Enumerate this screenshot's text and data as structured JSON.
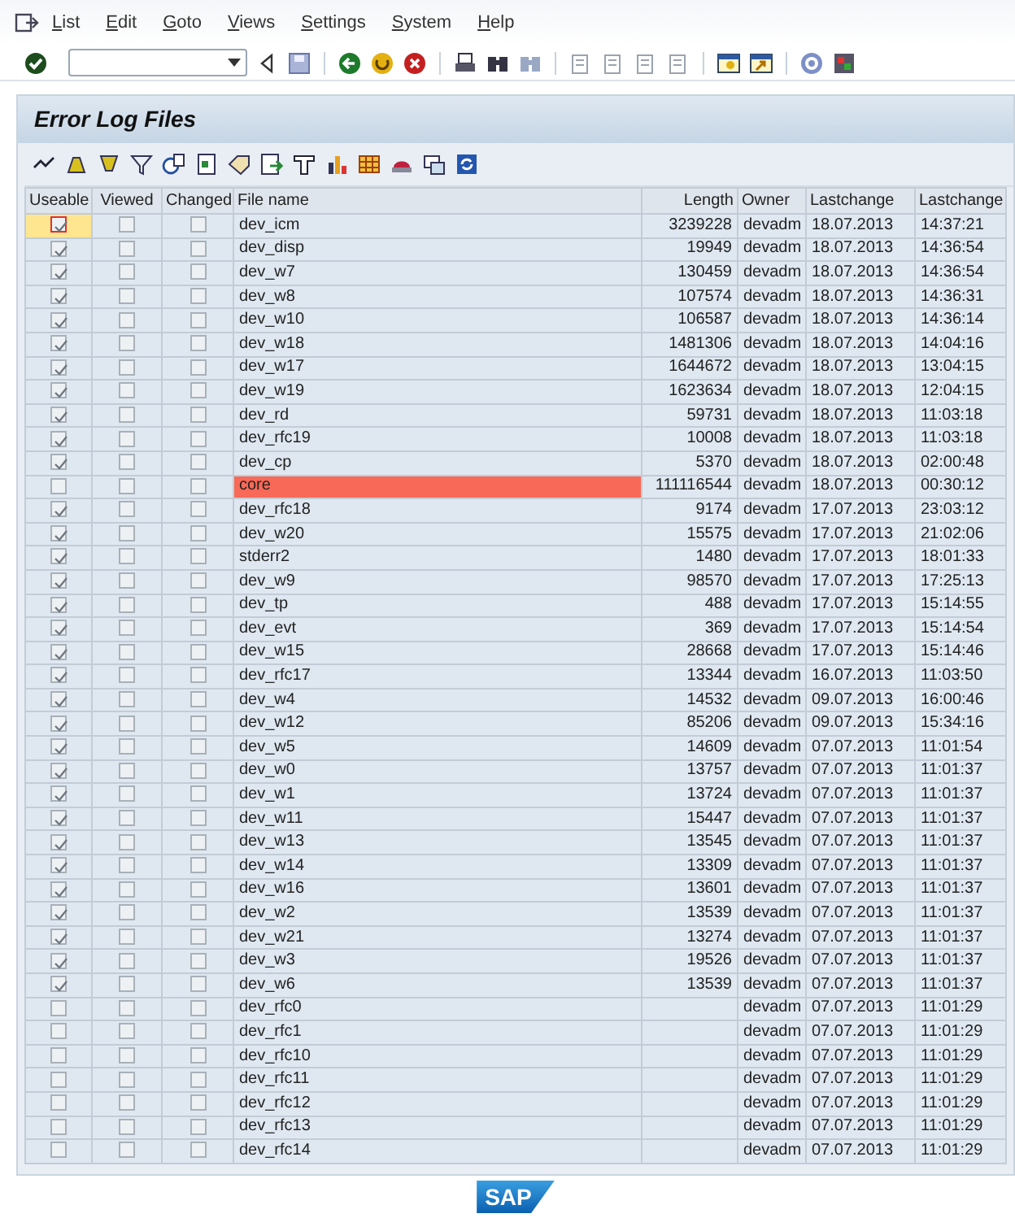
{
  "menu": [
    {
      "label": "List"
    },
    {
      "label": "Edit"
    },
    {
      "label": "Goto"
    },
    {
      "label": "Views"
    },
    {
      "label": "Settings"
    },
    {
      "label": "System"
    },
    {
      "label": "Help"
    }
  ],
  "title": "Error Log Files",
  "table": {
    "columns": [
      "Useable",
      "Viewed",
      "Changed",
      "File name",
      "Length",
      "Owner",
      "Lastchange",
      "Lastchange"
    ],
    "rows": [
      {
        "useable": true,
        "viewed": false,
        "changed": false,
        "file_name": "dev_icm",
        "length": "3239228",
        "owner": "devadm",
        "date": "18.07.2013",
        "time": "14:37:21",
        "error": false,
        "focused": true
      },
      {
        "useable": true,
        "viewed": false,
        "changed": false,
        "file_name": "dev_disp",
        "length": "19949",
        "owner": "devadm",
        "date": "18.07.2013",
        "time": "14:36:54",
        "error": false,
        "focused": false
      },
      {
        "useable": true,
        "viewed": false,
        "changed": false,
        "file_name": "dev_w7",
        "length": "130459",
        "owner": "devadm",
        "date": "18.07.2013",
        "time": "14:36:54",
        "error": false,
        "focused": false
      },
      {
        "useable": true,
        "viewed": false,
        "changed": false,
        "file_name": "dev_w8",
        "length": "107574",
        "owner": "devadm",
        "date": "18.07.2013",
        "time": "14:36:31",
        "error": false,
        "focused": false
      },
      {
        "useable": true,
        "viewed": false,
        "changed": false,
        "file_name": "dev_w10",
        "length": "106587",
        "owner": "devadm",
        "date": "18.07.2013",
        "time": "14:36:14",
        "error": false,
        "focused": false
      },
      {
        "useable": true,
        "viewed": false,
        "changed": false,
        "file_name": "dev_w18",
        "length": "1481306",
        "owner": "devadm",
        "date": "18.07.2013",
        "time": "14:04:16",
        "error": false,
        "focused": false
      },
      {
        "useable": true,
        "viewed": false,
        "changed": false,
        "file_name": "dev_w17",
        "length": "1644672",
        "owner": "devadm",
        "date": "18.07.2013",
        "time": "13:04:15",
        "error": false,
        "focused": false
      },
      {
        "useable": true,
        "viewed": false,
        "changed": false,
        "file_name": "dev_w19",
        "length": "1623634",
        "owner": "devadm",
        "date": "18.07.2013",
        "time": "12:04:15",
        "error": false,
        "focused": false
      },
      {
        "useable": true,
        "viewed": false,
        "changed": false,
        "file_name": "dev_rd",
        "length": "59731",
        "owner": "devadm",
        "date": "18.07.2013",
        "time": "11:03:18",
        "error": false,
        "focused": false
      },
      {
        "useable": true,
        "viewed": false,
        "changed": false,
        "file_name": "dev_rfc19",
        "length": "10008",
        "owner": "devadm",
        "date": "18.07.2013",
        "time": "11:03:18",
        "error": false,
        "focused": false
      },
      {
        "useable": true,
        "viewed": false,
        "changed": false,
        "file_name": "dev_cp",
        "length": "5370",
        "owner": "devadm",
        "date": "18.07.2013",
        "time": "02:00:48",
        "error": false,
        "focused": false
      },
      {
        "useable": false,
        "viewed": false,
        "changed": false,
        "file_name": "core",
        "length": "111116544",
        "owner": "devadm",
        "date": "18.07.2013",
        "time": "00:30:12",
        "error": true,
        "focused": false
      },
      {
        "useable": true,
        "viewed": false,
        "changed": false,
        "file_name": "dev_rfc18",
        "length": "9174",
        "owner": "devadm",
        "date": "17.07.2013",
        "time": "23:03:12",
        "error": false,
        "focused": false
      },
      {
        "useable": true,
        "viewed": false,
        "changed": false,
        "file_name": "dev_w20",
        "length": "15575",
        "owner": "devadm",
        "date": "17.07.2013",
        "time": "21:02:06",
        "error": false,
        "focused": false
      },
      {
        "useable": true,
        "viewed": false,
        "changed": false,
        "file_name": "stderr2",
        "length": "1480",
        "owner": "devadm",
        "date": "17.07.2013",
        "time": "18:01:33",
        "error": false,
        "focused": false
      },
      {
        "useable": true,
        "viewed": false,
        "changed": false,
        "file_name": "dev_w9",
        "length": "98570",
        "owner": "devadm",
        "date": "17.07.2013",
        "time": "17:25:13",
        "error": false,
        "focused": false
      },
      {
        "useable": true,
        "viewed": false,
        "changed": false,
        "file_name": "dev_tp",
        "length": "488",
        "owner": "devadm",
        "date": "17.07.2013",
        "time": "15:14:55",
        "error": false,
        "focused": false
      },
      {
        "useable": true,
        "viewed": false,
        "changed": false,
        "file_name": "dev_evt",
        "length": "369",
        "owner": "devadm",
        "date": "17.07.2013",
        "time": "15:14:54",
        "error": false,
        "focused": false
      },
      {
        "useable": true,
        "viewed": false,
        "changed": false,
        "file_name": "dev_w15",
        "length": "28668",
        "owner": "devadm",
        "date": "17.07.2013",
        "time": "15:14:46",
        "error": false,
        "focused": false
      },
      {
        "useable": true,
        "viewed": false,
        "changed": false,
        "file_name": "dev_rfc17",
        "length": "13344",
        "owner": "devadm",
        "date": "16.07.2013",
        "time": "11:03:50",
        "error": false,
        "focused": false
      },
      {
        "useable": true,
        "viewed": false,
        "changed": false,
        "file_name": "dev_w4",
        "length": "14532",
        "owner": "devadm",
        "date": "09.07.2013",
        "time": "16:00:46",
        "error": false,
        "focused": false
      },
      {
        "useable": true,
        "viewed": false,
        "changed": false,
        "file_name": "dev_w12",
        "length": "85206",
        "owner": "devadm",
        "date": "09.07.2013",
        "time": "15:34:16",
        "error": false,
        "focused": false
      },
      {
        "useable": true,
        "viewed": false,
        "changed": false,
        "file_name": "dev_w5",
        "length": "14609",
        "owner": "devadm",
        "date": "07.07.2013",
        "time": "11:01:54",
        "error": false,
        "focused": false
      },
      {
        "useable": true,
        "viewed": false,
        "changed": false,
        "file_name": "dev_w0",
        "length": "13757",
        "owner": "devadm",
        "date": "07.07.2013",
        "time": "11:01:37",
        "error": false,
        "focused": false
      },
      {
        "useable": true,
        "viewed": false,
        "changed": false,
        "file_name": "dev_w1",
        "length": "13724",
        "owner": "devadm",
        "date": "07.07.2013",
        "time": "11:01:37",
        "error": false,
        "focused": false
      },
      {
        "useable": true,
        "viewed": false,
        "changed": false,
        "file_name": "dev_w11",
        "length": "15447",
        "owner": "devadm",
        "date": "07.07.2013",
        "time": "11:01:37",
        "error": false,
        "focused": false
      },
      {
        "useable": true,
        "viewed": false,
        "changed": false,
        "file_name": "dev_w13",
        "length": "13545",
        "owner": "devadm",
        "date": "07.07.2013",
        "time": "11:01:37",
        "error": false,
        "focused": false
      },
      {
        "useable": true,
        "viewed": false,
        "changed": false,
        "file_name": "dev_w14",
        "length": "13309",
        "owner": "devadm",
        "date": "07.07.2013",
        "time": "11:01:37",
        "error": false,
        "focused": false
      },
      {
        "useable": true,
        "viewed": false,
        "changed": false,
        "file_name": "dev_w16",
        "length": "13601",
        "owner": "devadm",
        "date": "07.07.2013",
        "time": "11:01:37",
        "error": false,
        "focused": false
      },
      {
        "useable": true,
        "viewed": false,
        "changed": false,
        "file_name": "dev_w2",
        "length": "13539",
        "owner": "devadm",
        "date": "07.07.2013",
        "time": "11:01:37",
        "error": false,
        "focused": false
      },
      {
        "useable": true,
        "viewed": false,
        "changed": false,
        "file_name": "dev_w21",
        "length": "13274",
        "owner": "devadm",
        "date": "07.07.2013",
        "time": "11:01:37",
        "error": false,
        "focused": false
      },
      {
        "useable": true,
        "viewed": false,
        "changed": false,
        "file_name": "dev_w3",
        "length": "19526",
        "owner": "devadm",
        "date": "07.07.2013",
        "time": "11:01:37",
        "error": false,
        "focused": false
      },
      {
        "useable": true,
        "viewed": false,
        "changed": false,
        "file_name": "dev_w6",
        "length": "13539",
        "owner": "devadm",
        "date": "07.07.2013",
        "time": "11:01:37",
        "error": false,
        "focused": false
      },
      {
        "useable": false,
        "viewed": false,
        "changed": false,
        "file_name": "dev_rfc0",
        "owner": "devadm",
        "date": "07.07.2013",
        "time": "11:01:29",
        "error": false,
        "focused": false
      },
      {
        "useable": false,
        "viewed": false,
        "changed": false,
        "file_name": "dev_rfc1",
        "owner": "devadm",
        "date": "07.07.2013",
        "time": "11:01:29",
        "error": false,
        "focused": false
      },
      {
        "useable": false,
        "viewed": false,
        "changed": false,
        "file_name": "dev_rfc10",
        "owner": "devadm",
        "date": "07.07.2013",
        "time": "11:01:29",
        "error": false,
        "focused": false
      },
      {
        "useable": false,
        "viewed": false,
        "changed": false,
        "file_name": "dev_rfc11",
        "owner": "devadm",
        "date": "07.07.2013",
        "time": "11:01:29",
        "error": false,
        "focused": false
      },
      {
        "useable": false,
        "viewed": false,
        "changed": false,
        "file_name": "dev_rfc12",
        "owner": "devadm",
        "date": "07.07.2013",
        "time": "11:01:29",
        "error": false,
        "focused": false
      },
      {
        "useable": false,
        "viewed": false,
        "changed": false,
        "file_name": "dev_rfc13",
        "owner": "devadm",
        "date": "07.07.2013",
        "time": "11:01:29",
        "error": false,
        "focused": false
      },
      {
        "useable": false,
        "viewed": false,
        "changed": false,
        "file_name": "dev_rfc14",
        "owner": "devadm",
        "date": "07.07.2013",
        "time": "11:01:29",
        "error": false,
        "focused": false
      }
    ]
  },
  "logo": "SAP"
}
